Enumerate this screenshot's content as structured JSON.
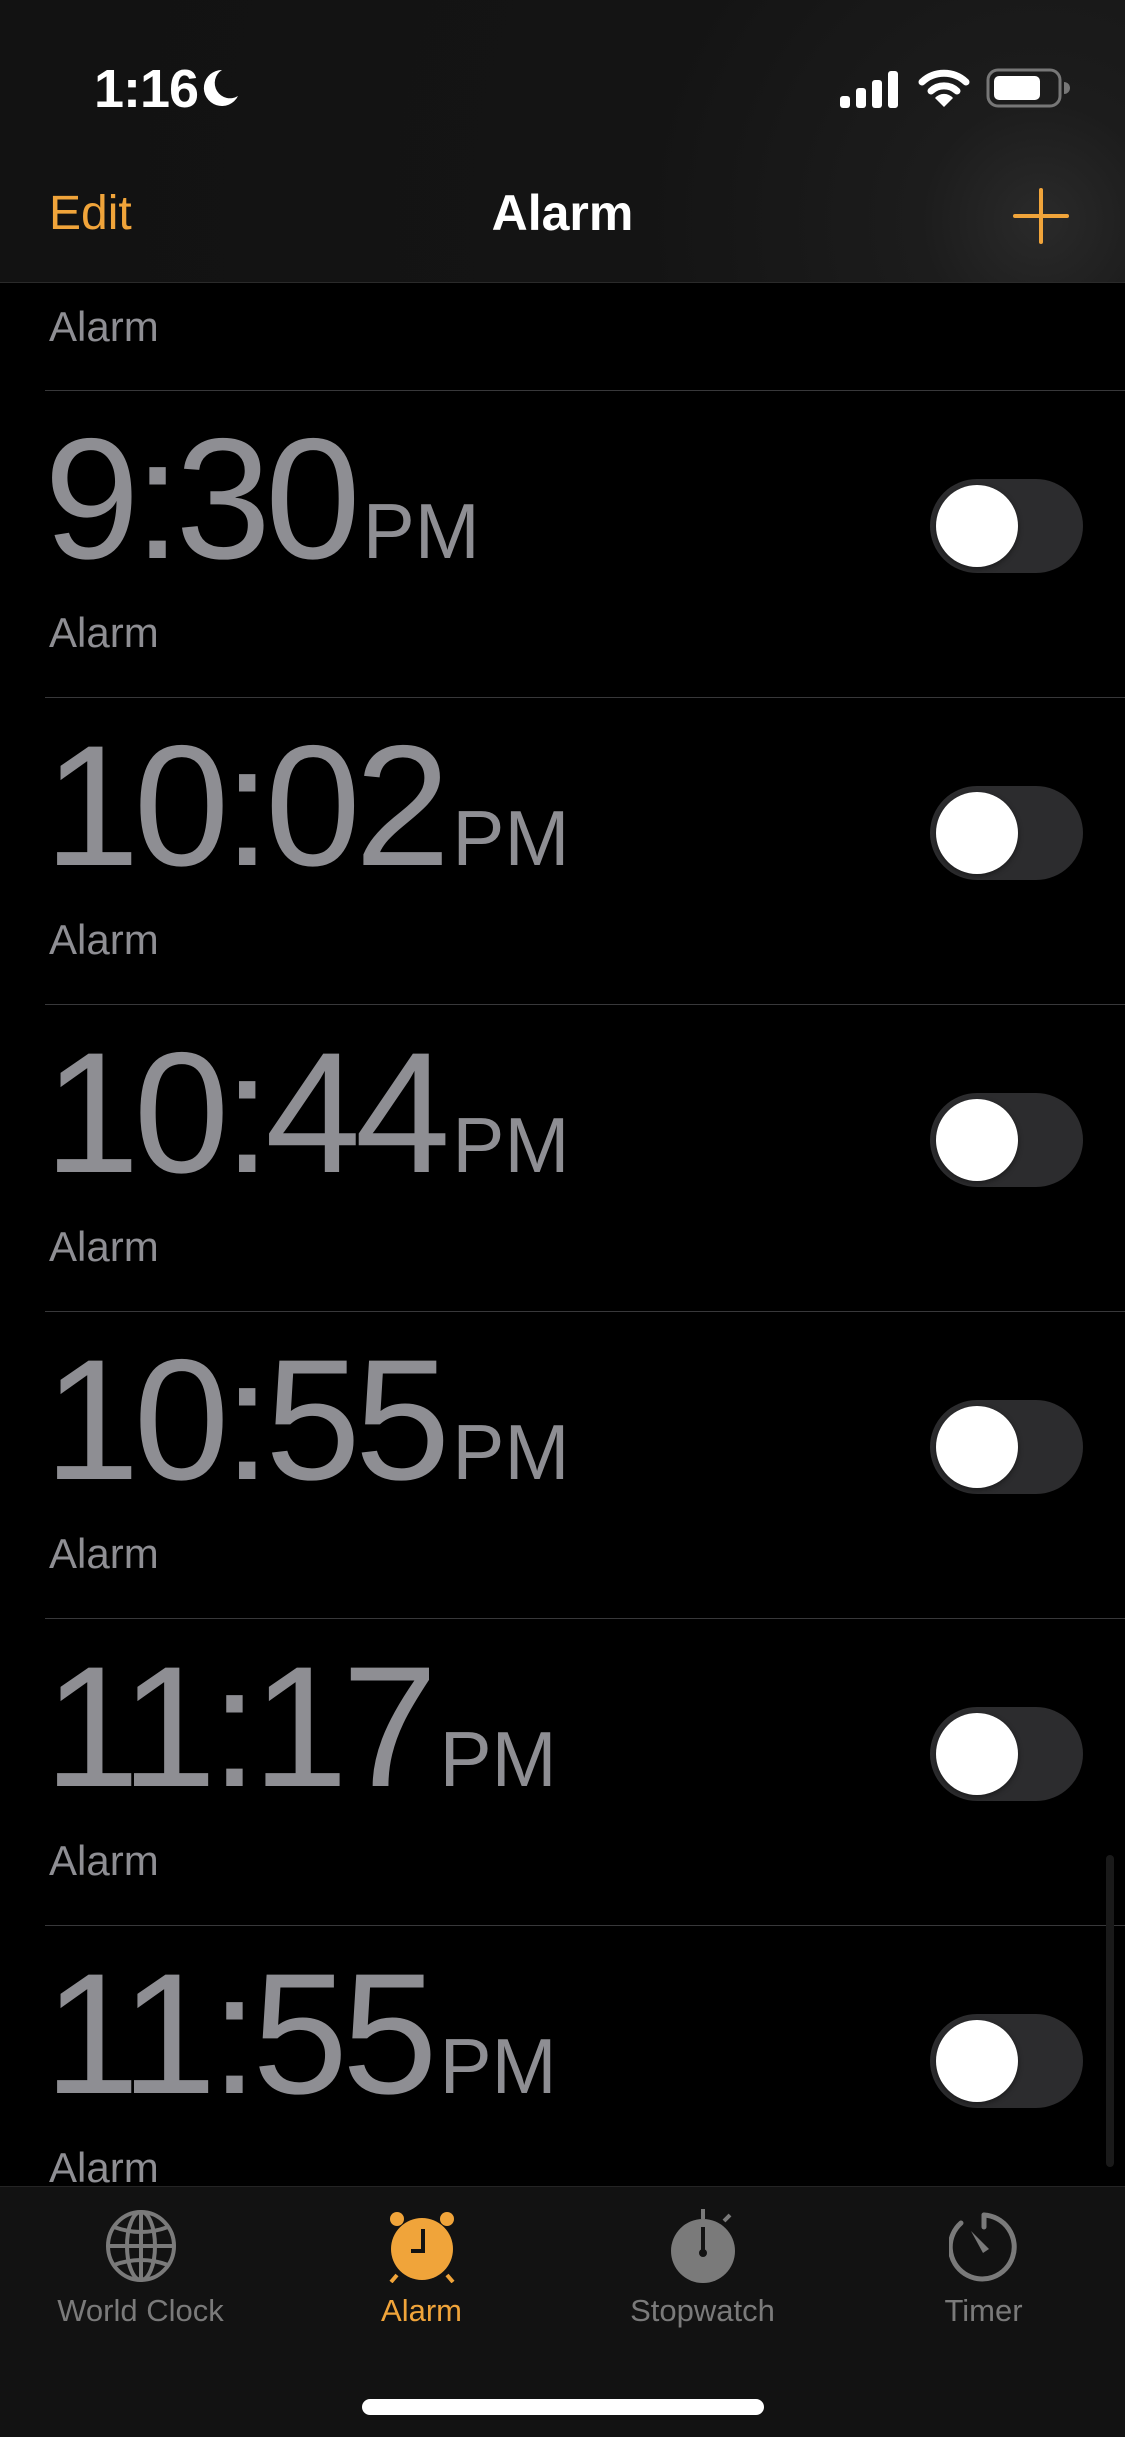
{
  "status_bar": {
    "time": "1:16",
    "focus_icon": "moon-icon",
    "signal_icon": "cellular-signal-icon",
    "wifi_icon": "wifi-icon",
    "battery_icon": "battery-icon"
  },
  "nav": {
    "edit_label": "Edit",
    "title": "Alarm",
    "add_icon": "plus-icon"
  },
  "list": {
    "partial_label": "Alarm",
    "alarms": [
      {
        "time": "9:30",
        "ampm": "PM",
        "label": "Alarm",
        "enabled": false
      },
      {
        "time": "10:02",
        "ampm": "PM",
        "label": "Alarm",
        "enabled": false
      },
      {
        "time": "10:44",
        "ampm": "PM",
        "label": "Alarm",
        "enabled": false
      },
      {
        "time": "10:55",
        "ampm": "PM",
        "label": "Alarm",
        "enabled": false
      },
      {
        "time": "11:17",
        "ampm": "PM",
        "label": "Alarm",
        "enabled": false
      },
      {
        "time": "11:55",
        "ampm": "PM",
        "label": "Alarm",
        "enabled": false
      }
    ]
  },
  "tabs": [
    {
      "label": "World Clock",
      "icon": "globe-icon",
      "active": false
    },
    {
      "label": "Alarm",
      "icon": "alarm-clock-icon",
      "active": true
    },
    {
      "label": "Stopwatch",
      "icon": "stopwatch-icon",
      "active": false
    },
    {
      "label": "Timer",
      "icon": "timer-icon",
      "active": false
    }
  ],
  "colors": {
    "accent": "#f0a43a",
    "secondary_text": "#8e8e93",
    "toggle_off_track": "#2c2c2e",
    "tab_inactive": "#7a7a7a"
  }
}
